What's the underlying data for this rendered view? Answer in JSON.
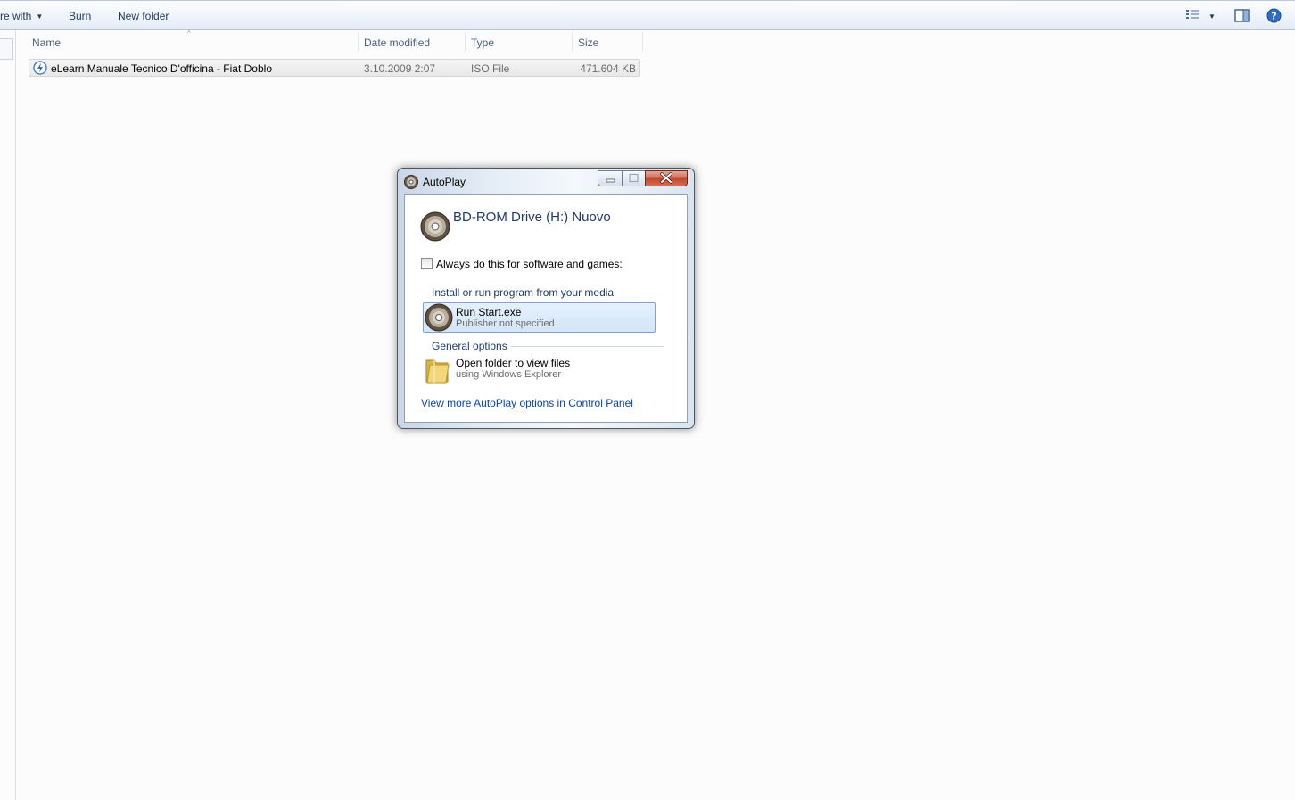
{
  "toolbar": {
    "share_with_label": "re with",
    "burn_label": "Burn",
    "new_folder_label": "New folder",
    "icons": [
      "view-options-icon",
      "chevron-down-icon",
      "preview-pane-icon",
      "help-icon"
    ]
  },
  "columns": {
    "name": "Name",
    "date_modified": "Date modified",
    "type": "Type",
    "size": "Size"
  },
  "files": [
    {
      "name": "eLearn Manuale Tecnico D'officina - Fiat Doblo",
      "date_modified": "3.10.2009 2:07",
      "type": "ISO File",
      "size": "471.604 KB",
      "icon": "iso-file-icon"
    }
  ],
  "autoplay": {
    "title": "AutoPlay",
    "drive_title": "BD-ROM Drive (H:) Nuovo",
    "always_label": "Always do this for software and games:",
    "always_checked": false,
    "section_install": "Install or run program from your media",
    "run_title": "Run Start.exe",
    "run_subtitle": "Publisher not specified",
    "section_general": "General options",
    "open_title": "Open folder to view files",
    "open_subtitle": "using Windows Explorer",
    "more_link": "View more AutoPlay options in Control Panel",
    "icons": [
      "disc-icon",
      "folder-icon",
      "minimize-icon",
      "maximize-icon",
      "close-icon"
    ]
  }
}
